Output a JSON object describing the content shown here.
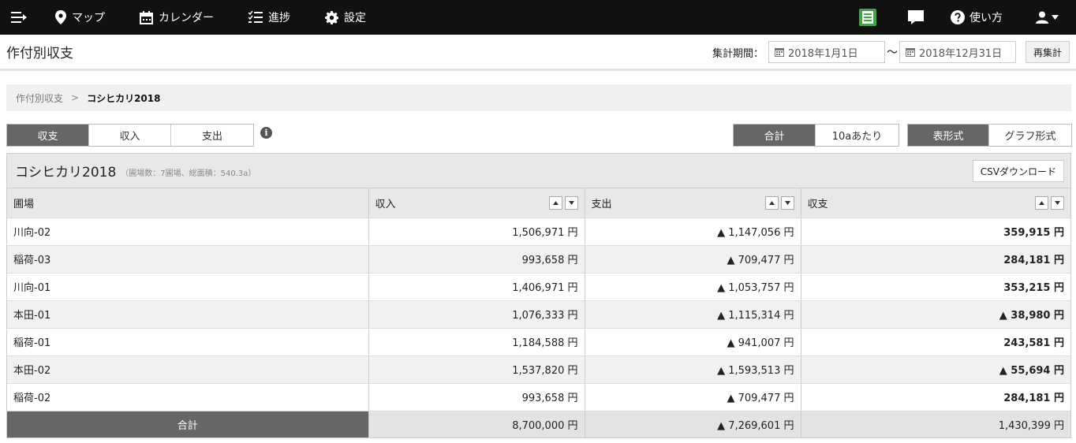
{
  "nav": {
    "items": [
      {
        "label": "マップ",
        "icon": "map-pin-icon"
      },
      {
        "label": "カレンダー",
        "icon": "calendar-icon"
      },
      {
        "label": "進捗",
        "icon": "checklist-icon"
      },
      {
        "label": "設定",
        "icon": "gear-icon"
      }
    ],
    "help_label": "使い方"
  },
  "page": {
    "title": "作付別収支",
    "period_label": "集計期間：",
    "date_from": "2018年1月1日",
    "date_tilde": "〜",
    "date_to": "2018年12月31日",
    "recalc_label": "再集計"
  },
  "breadcrumb": {
    "parent": "作付別収支",
    "separator": ">",
    "current": "コシヒカリ2018"
  },
  "tabs_type": [
    "収支",
    "収入",
    "支出"
  ],
  "tabs_unit": [
    "合計",
    "10aあたり"
  ],
  "tabs_view": [
    "表形式",
    "グラフ形式"
  ],
  "info_glyph": "i",
  "panel": {
    "title": "コシヒカリ2018",
    "meta": "（圃場数：7圃場、総面積：540.3a）",
    "csv_label": "CSVダウンロード"
  },
  "table": {
    "headers": [
      "圃場",
      "収入",
      "支出",
      "収支"
    ],
    "rows": [
      {
        "field": "川向-02",
        "income": "1,506,971 円",
        "expense": "▲ 1,147,056 円",
        "balance": "359,915 円"
      },
      {
        "field": "稲荷-03",
        "income": "993,658 円",
        "expense": "▲ 709,477 円",
        "balance": "284,181 円"
      },
      {
        "field": "川向-01",
        "income": "1,406,971 円",
        "expense": "▲ 1,053,757 円",
        "balance": "353,215 円"
      },
      {
        "field": "本田-01",
        "income": "1,076,333 円",
        "expense": "▲ 1,115,314 円",
        "balance": "▲ 38,980 円"
      },
      {
        "field": "稲荷-01",
        "income": "1,184,588 円",
        "expense": "▲ 941,007 円",
        "balance": "243,581 円"
      },
      {
        "field": "本田-02",
        "income": "1,537,820 円",
        "expense": "▲ 1,593,513 円",
        "balance": "▲ 55,694 円"
      },
      {
        "field": "稲荷-02",
        "income": "993,658 円",
        "expense": "▲ 709,477 円",
        "balance": "284,181 円"
      }
    ],
    "total": {
      "label": "合計",
      "income": "8,700,000 円",
      "expense": "▲ 7,269,601 円",
      "balance": "1,430,399 円"
    }
  },
  "colors": {
    "topbar": "#111111",
    "active_tab": "#666666",
    "book_icon": "#3aa845"
  }
}
